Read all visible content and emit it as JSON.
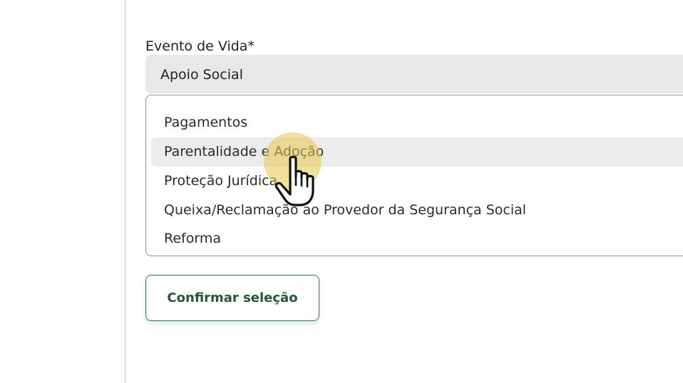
{
  "field": {
    "label": "Evento de Vida*",
    "selected_value": "Apoio Social"
  },
  "dropdown": {
    "options": [
      {
        "label": "Pagamentos"
      },
      {
        "label": "Parentalidade e Adoção"
      },
      {
        "label": "Proteção Jurídica"
      },
      {
        "label": "Queixa/Reclamação ao Provedor da Segurança Social"
      },
      {
        "label": "Reforma"
      }
    ],
    "hovered_option": "Parentalidade e Adoção"
  },
  "actions": {
    "confirm_label": "Confirmar seleção"
  },
  "colors": {
    "accent_green": "#2e7d4a",
    "button_text": "#1f5a33",
    "click_highlight": "#e8c64a",
    "select_background": "#e8e8e8",
    "hover_row": "#ececec"
  },
  "icons": {
    "cursor": "hand-pointer-icon"
  }
}
